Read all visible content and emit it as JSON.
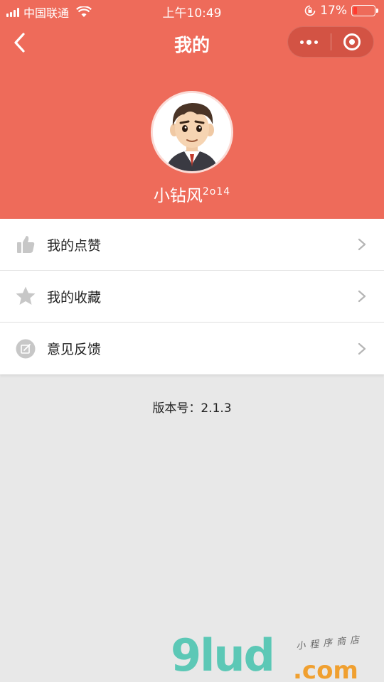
{
  "status_bar": {
    "carrier": "中国联通",
    "time": "上午10:49",
    "battery_text": "17%"
  },
  "nav": {
    "title": "我的"
  },
  "profile": {
    "nickname": "小钻风",
    "nickname_suffix": "2o14"
  },
  "menu": [
    {
      "label": "我的点赞",
      "icon": "thumbs-up-icon"
    },
    {
      "label": "我的收藏",
      "icon": "star-icon"
    },
    {
      "label": "意见反馈",
      "icon": "feedback-edit-icon"
    }
  ],
  "version_text": "版本号：2.1.3",
  "watermark": {
    "logo": "9lud",
    "sub": ".com",
    "tag": "小程序商店"
  },
  "colors": {
    "header": "#ee6b5a",
    "background": "#e8e8e8",
    "icon_gray": "#c7c7c7"
  }
}
